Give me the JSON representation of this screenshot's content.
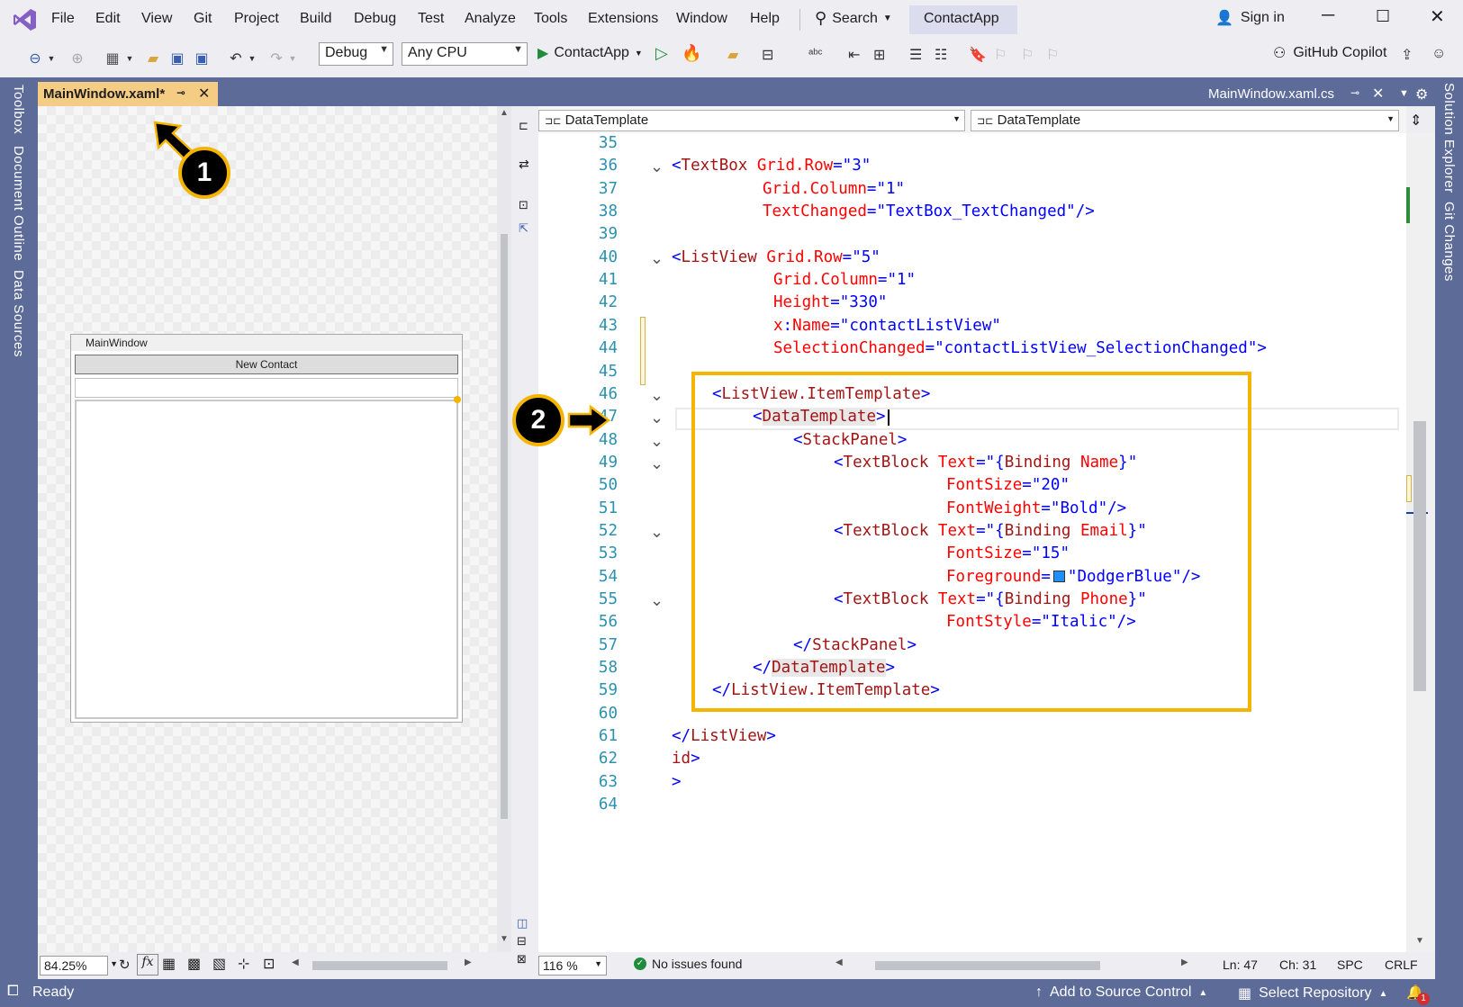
{
  "menu": {
    "file": "File",
    "edit": "Edit",
    "view": "View",
    "git": "Git",
    "project": "Project",
    "build": "Build",
    "debug": "Debug",
    "test": "Test",
    "analyze": "Analyze",
    "tools": "Tools",
    "extensions": "Extensions",
    "window": "Window",
    "help": "Help",
    "search": "Search",
    "app_name": "ContactApp",
    "sign_in": "Sign in"
  },
  "toolbar": {
    "config": "Debug",
    "platform": "Any CPU",
    "run_target": "ContactApp",
    "copilot": "GitHub Copilot"
  },
  "side_tabs": {
    "left": [
      "Toolbox",
      "Document Outline",
      "Data Sources"
    ],
    "right": [
      "Solution Explorer",
      "Git Changes"
    ]
  },
  "tabs": {
    "active": "MainWindow.xaml*",
    "inactive": "MainWindow.xaml.cs"
  },
  "designer": {
    "window_title": "MainWindow",
    "button_label": "New Contact",
    "zoom": "84.25%",
    "fx": "fx"
  },
  "editor": {
    "nav_left": "DataTemplate",
    "nav_right": "DataTemplate",
    "zoom": "116 %",
    "issues": "No issues found",
    "ln": "Ln: 47",
    "ch": "Ch: 31",
    "spc": "SPC",
    "crlf": "CRLF",
    "lines": [
      {
        "n": "35",
        "segs": []
      },
      {
        "n": "36",
        "segs": [
          [
            "br",
            "<"
          ],
          [
            "tag",
            "TextBox"
          ],
          [
            "attr",
            " Grid.Row"
          ],
          [
            "br",
            "=\""
          ],
          [
            "val",
            "3"
          ],
          [
            "br",
            "\""
          ]
        ]
      },
      {
        "n": "37",
        "segs": [
          [
            "attr",
            "Grid.Column"
          ],
          [
            "br",
            "=\""
          ],
          [
            "val",
            "1"
          ],
          [
            "br",
            "\""
          ]
        ]
      },
      {
        "n": "38",
        "segs": [
          [
            "attr",
            "TextChanged"
          ],
          [
            "br",
            "=\""
          ],
          [
            "val",
            "TextBox_TextChanged"
          ],
          [
            "br",
            "\"/>"
          ]
        ]
      },
      {
        "n": "39",
        "segs": []
      },
      {
        "n": "40",
        "segs": [
          [
            "br",
            "<"
          ],
          [
            "tag",
            "ListView"
          ],
          [
            "attr",
            " Grid.Row"
          ],
          [
            "br",
            "=\""
          ],
          [
            "val",
            "5"
          ],
          [
            "br",
            "\""
          ]
        ]
      },
      {
        "n": "41",
        "segs": [
          [
            "attr",
            "Grid.Column"
          ],
          [
            "br",
            "=\""
          ],
          [
            "val",
            "1"
          ],
          [
            "br",
            "\""
          ]
        ]
      },
      {
        "n": "42",
        "segs": [
          [
            "attr",
            "Height"
          ],
          [
            "br",
            "=\""
          ],
          [
            "val",
            "330"
          ],
          [
            "br",
            "\""
          ]
        ]
      },
      {
        "n": "43",
        "segs": [
          [
            "attr",
            "x"
          ],
          [
            "br",
            ":"
          ],
          [
            "attr",
            "Name"
          ],
          [
            "br",
            "=\""
          ],
          [
            "val",
            "contactListView"
          ],
          [
            "br",
            "\""
          ]
        ]
      },
      {
        "n": "44",
        "segs": [
          [
            "attr",
            "SelectionChanged"
          ],
          [
            "br",
            "=\""
          ],
          [
            "val",
            "contactListView_SelectionChanged"
          ],
          [
            "br",
            "\">"
          ]
        ]
      },
      {
        "n": "45",
        "segs": []
      },
      {
        "n": "46",
        "segs": [
          [
            "br",
            "<"
          ],
          [
            "tag",
            "ListView.ItemTemplate"
          ],
          [
            "br",
            ">"
          ]
        ]
      },
      {
        "n": "47",
        "segs": [
          [
            "br",
            "<"
          ],
          [
            "tag",
            "DataTemplate"
          ],
          [
            "br",
            ">"
          ]
        ]
      },
      {
        "n": "48",
        "segs": [
          [
            "br",
            "<"
          ],
          [
            "tag",
            "StackPanel"
          ],
          [
            "br",
            ">"
          ]
        ]
      },
      {
        "n": "49",
        "segs": [
          [
            "br",
            "<"
          ],
          [
            "tag",
            "TextBlock"
          ],
          [
            "attr",
            " Text"
          ],
          [
            "br",
            "=\""
          ],
          [
            "val",
            "{"
          ],
          [
            "tag",
            "Binding"
          ],
          [
            "attr",
            " Name"
          ],
          [
            "val",
            "}"
          ],
          [
            "br",
            "\""
          ]
        ]
      },
      {
        "n": "50",
        "segs": [
          [
            "attr",
            "FontSize"
          ],
          [
            "br",
            "=\""
          ],
          [
            "val",
            "20"
          ],
          [
            "br",
            "\""
          ]
        ]
      },
      {
        "n": "51",
        "segs": [
          [
            "attr",
            "FontWeight"
          ],
          [
            "br",
            "=\""
          ],
          [
            "val",
            "Bold"
          ],
          [
            "br",
            "\"/>"
          ]
        ]
      },
      {
        "n": "52",
        "segs": [
          [
            "br",
            "<"
          ],
          [
            "tag",
            "TextBlock"
          ],
          [
            "attr",
            " Text"
          ],
          [
            "br",
            "=\""
          ],
          [
            "val",
            "{"
          ],
          [
            "tag",
            "Binding"
          ],
          [
            "attr",
            " Email"
          ],
          [
            "val",
            "}"
          ],
          [
            "br",
            "\""
          ]
        ]
      },
      {
        "n": "53",
        "segs": [
          [
            "attr",
            "FontSize"
          ],
          [
            "br",
            "=\""
          ],
          [
            "val",
            "15"
          ],
          [
            "br",
            "\""
          ]
        ]
      },
      {
        "n": "54",
        "segs": [
          [
            "attr",
            "Foreground"
          ],
          [
            "br",
            "="
          ],
          [
            "swatch",
            ""
          ],
          [
            "br",
            "\""
          ],
          [
            "val",
            "DodgerBlue"
          ],
          [
            "br",
            "\"/>"
          ]
        ]
      },
      {
        "n": "55",
        "segs": [
          [
            "br",
            "<"
          ],
          [
            "tag",
            "TextBlock"
          ],
          [
            "attr",
            " Text"
          ],
          [
            "br",
            "=\""
          ],
          [
            "val",
            "{"
          ],
          [
            "tag",
            "Binding"
          ],
          [
            "attr",
            " Phone"
          ],
          [
            "val",
            "}"
          ],
          [
            "br",
            "\""
          ]
        ]
      },
      {
        "n": "56",
        "segs": [
          [
            "attr",
            "FontStyle"
          ],
          [
            "br",
            "=\""
          ],
          [
            "val",
            "Italic"
          ],
          [
            "br",
            "\"/>"
          ]
        ]
      },
      {
        "n": "57",
        "segs": [
          [
            "br",
            "</"
          ],
          [
            "tag",
            "StackPanel"
          ],
          [
            "br",
            ">"
          ]
        ]
      },
      {
        "n": "58",
        "segs": [
          [
            "br",
            "</"
          ],
          [
            "tag",
            "DataTemplate"
          ],
          [
            "br",
            ">"
          ]
        ]
      },
      {
        "n": "59",
        "segs": [
          [
            "br",
            "</"
          ],
          [
            "tag",
            "ListView.ItemTemplate"
          ],
          [
            "br",
            ">"
          ]
        ]
      },
      {
        "n": "60",
        "segs": []
      },
      {
        "n": "61",
        "segs": [
          [
            "br",
            "</"
          ],
          [
            "tag",
            "ListView"
          ],
          [
            "br",
            ">"
          ]
        ]
      },
      {
        "n": "62",
        "segs": [
          [
            "tag",
            "id"
          ],
          [
            "br",
            ">"
          ]
        ]
      },
      {
        "n": "63",
        "segs": [
          [
            "br",
            ">"
          ]
        ]
      },
      {
        "n": "64",
        "segs": []
      }
    ]
  },
  "callouts": {
    "one": "1",
    "two": "2"
  },
  "status": {
    "ready": "Ready",
    "add_source": "Add to Source Control",
    "select_repo": "Select Repository",
    "notif_count": "1"
  },
  "colors": {
    "accent": "#f4b400",
    "chrome": "#5d6b99",
    "swatch": "#1e90ff"
  }
}
